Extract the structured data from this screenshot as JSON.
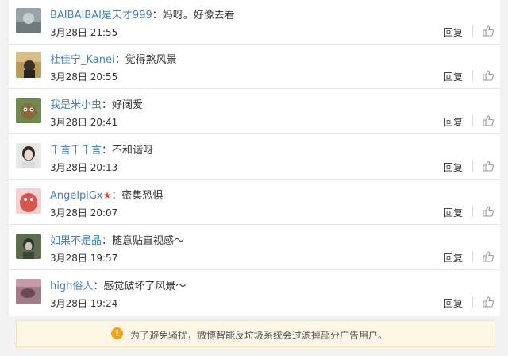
{
  "comments": [
    {
      "user": "BAIBAIBAI是天才999",
      "text": "：妈呀。好像去看",
      "time": "3月28日 21:55",
      "reply_label": "回复"
    },
    {
      "user": "杜佳宁_Kanei",
      "text": "：觉得煞风景",
      "time": "3月28日 20:55",
      "reply_label": "回复"
    },
    {
      "user": "我是米小虫",
      "text": "：好阔爱",
      "time": "3月28日 20:41",
      "reply_label": "回复"
    },
    {
      "user": "千言千千言",
      "text": "：不和谐呀",
      "time": "3月28日 20:13",
      "reply_label": "回复"
    },
    {
      "user": "AngelpiGx",
      "text": "：密集恐惧",
      "time": "3月28日 20:07",
      "reply_label": "回复",
      "badge": "★"
    },
    {
      "user": "如果不是晶",
      "text": "：随意贴直视感～",
      "time": "3月28日 19:57",
      "reply_label": "回复"
    },
    {
      "user": "high俗人",
      "text": "：感觉破坏了风景～",
      "time": "3月28日 19:24",
      "reply_label": "回复"
    }
  ],
  "notice": {
    "icon": "!",
    "text": "为了避免骚扰，微博智能反垃圾系统会过滤掉部分广告用户。"
  },
  "colors": {
    "username": "#4a7fb5",
    "notice_bg": "#fff7e6",
    "notice_icon": "#f2a31c"
  }
}
